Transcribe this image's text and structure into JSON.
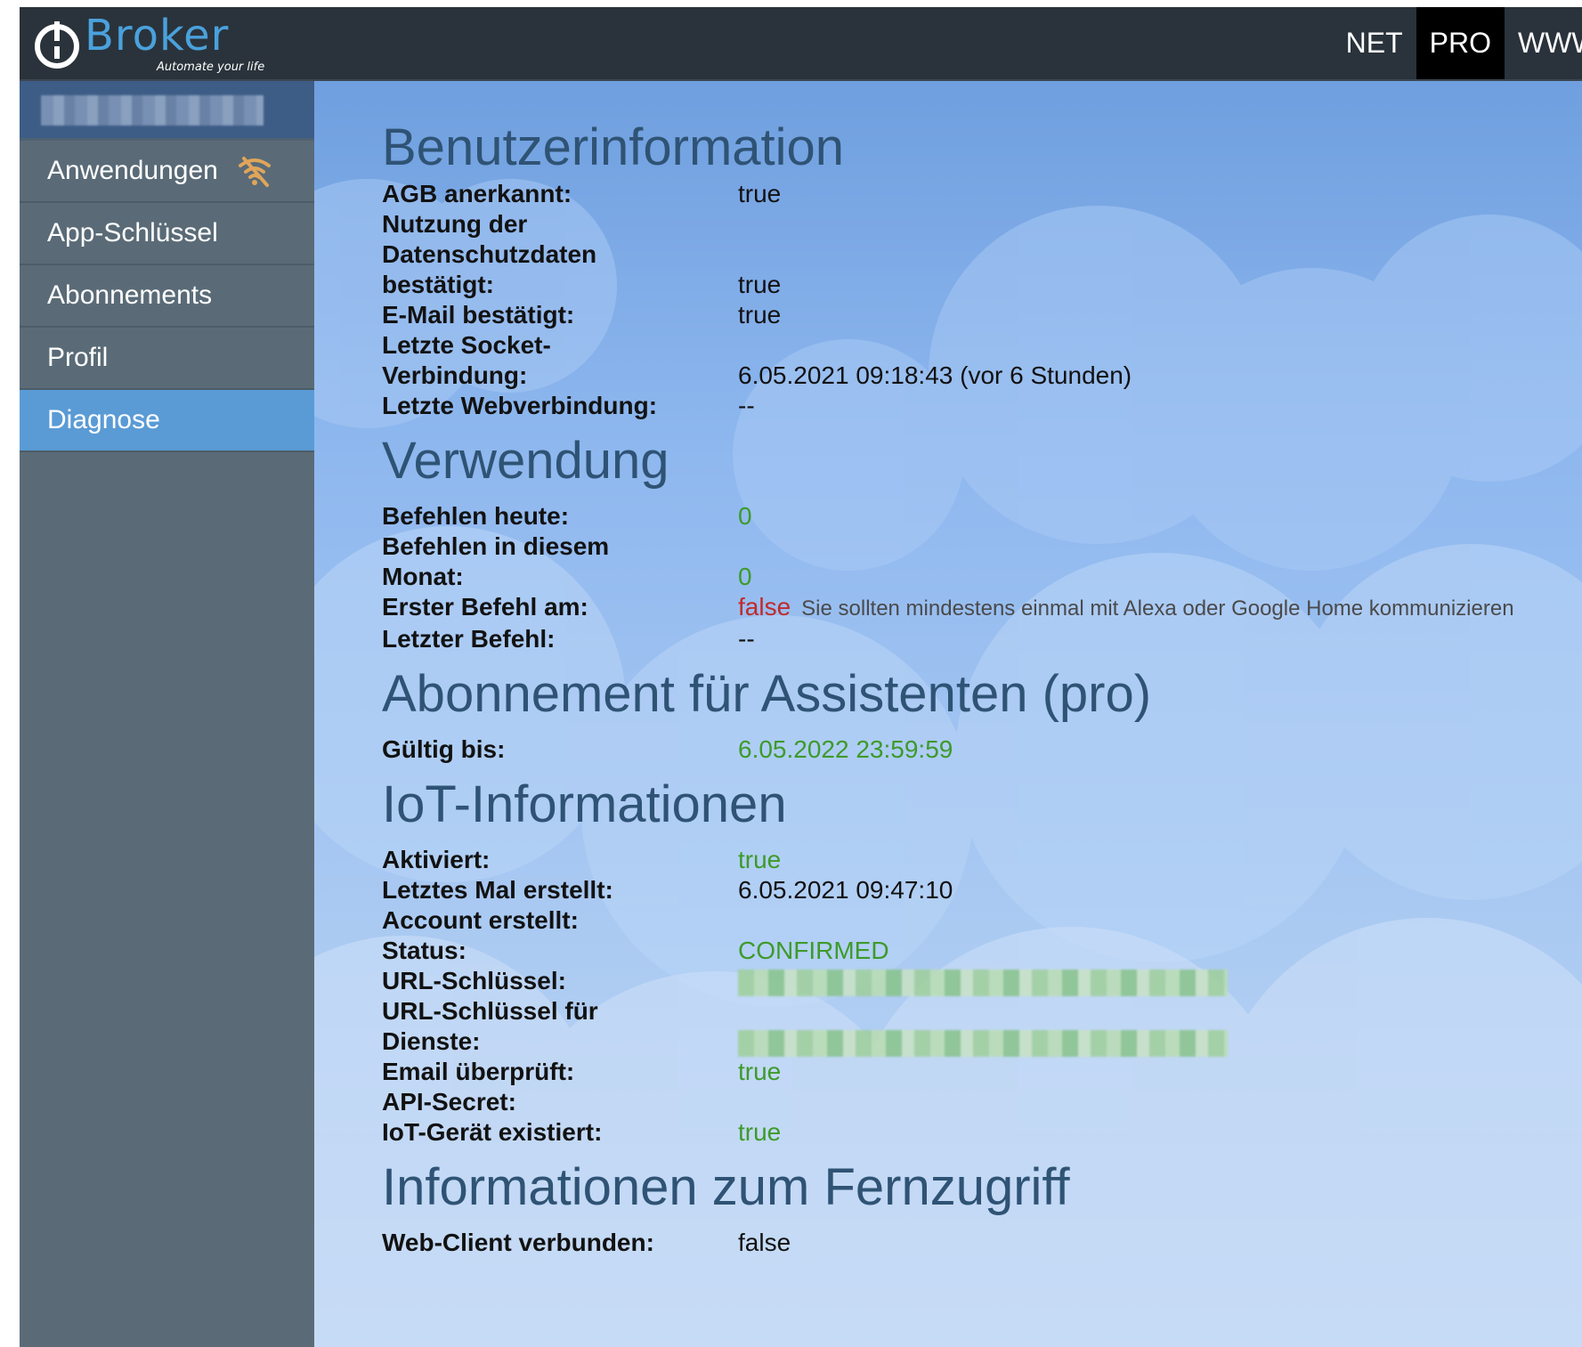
{
  "header": {
    "logo_text": "Broker",
    "logo_tagline": "Automate your life",
    "nav": [
      {
        "label": "NET",
        "active": false
      },
      {
        "label": "PRO",
        "active": true
      },
      {
        "label": "WWW",
        "active": false
      }
    ]
  },
  "sidebar": {
    "items": [
      {
        "label": "Anwendungen",
        "icon": "wifi-off-icon",
        "active": false
      },
      {
        "label": "App-Schlüssel",
        "active": false
      },
      {
        "label": "Abonnements",
        "active": false
      },
      {
        "label": "Profil",
        "active": false
      },
      {
        "label": "Diagnose",
        "active": true
      }
    ]
  },
  "sections": {
    "user": {
      "title": "Benutzerinformation",
      "agb_label": "AGB anerkannt:",
      "agb_value": "true",
      "privacy_label_1": "Nutzung der",
      "privacy_label_2": "Datenschutzdaten",
      "privacy_label_3": "bestätigt:",
      "privacy_value": "true",
      "email_label": "E-Mail bestätigt:",
      "email_value": "true",
      "socket_label_1": "Letzte Socket-",
      "socket_label_2": "Verbindung:",
      "socket_value": "6.05.2021 09:18:43 (vor 6 Stunden)",
      "web_label": "Letzte Webverbindung:",
      "web_value": "--"
    },
    "usage": {
      "title": "Verwendung",
      "today_label": "Befehlen heute:",
      "today_value": "0",
      "month_label_1": "Befehlen in diesem",
      "month_label_2": "Monat:",
      "month_value": "0",
      "first_label": "Erster Befehl am:",
      "first_value": "false",
      "first_hint": "Sie sollten mindestens einmal mit Alexa oder Google Home kommunizieren",
      "last_label": "Letzter Befehl:",
      "last_value": "--"
    },
    "subscription": {
      "title": "Abonnement für Assistenten (pro)",
      "valid_label": "Gültig bis:",
      "valid_value": "6.05.2022 23:59:59"
    },
    "iot": {
      "title": "IoT-Informationen",
      "activated_label": "Aktiviert:",
      "activated_value": "true",
      "created_label": "Letztes Mal erstellt:",
      "created_value": "6.05.2021 09:47:10",
      "account_label": "Account erstellt:",
      "status_label": "Status:",
      "status_value": "CONFIRMED",
      "urlkey_label": "URL-Schlüssel:",
      "urlkey_services_label_1": "URL-Schlüssel für",
      "urlkey_services_label_2": "Dienste:",
      "email_checked_label": "Email überprüft:",
      "email_checked_value": "true",
      "api_secret_label": "API-Secret:",
      "device_exists_label": "IoT-Gerät existiert:",
      "device_exists_value": "true"
    },
    "remote": {
      "title": "Informationen zum Fernzugriff",
      "webclient_label": "Web-Client verbunden:",
      "webclient_value": "false"
    }
  },
  "colors": {
    "topbar": "#2a333b",
    "sidebar": "#5a6b77",
    "sidebar_active": "#5a9bd5",
    "heading": "#2f5374",
    "green": "#3e9a2a",
    "red": "#c22a2a",
    "wifi_icon": "#e0a55a"
  }
}
